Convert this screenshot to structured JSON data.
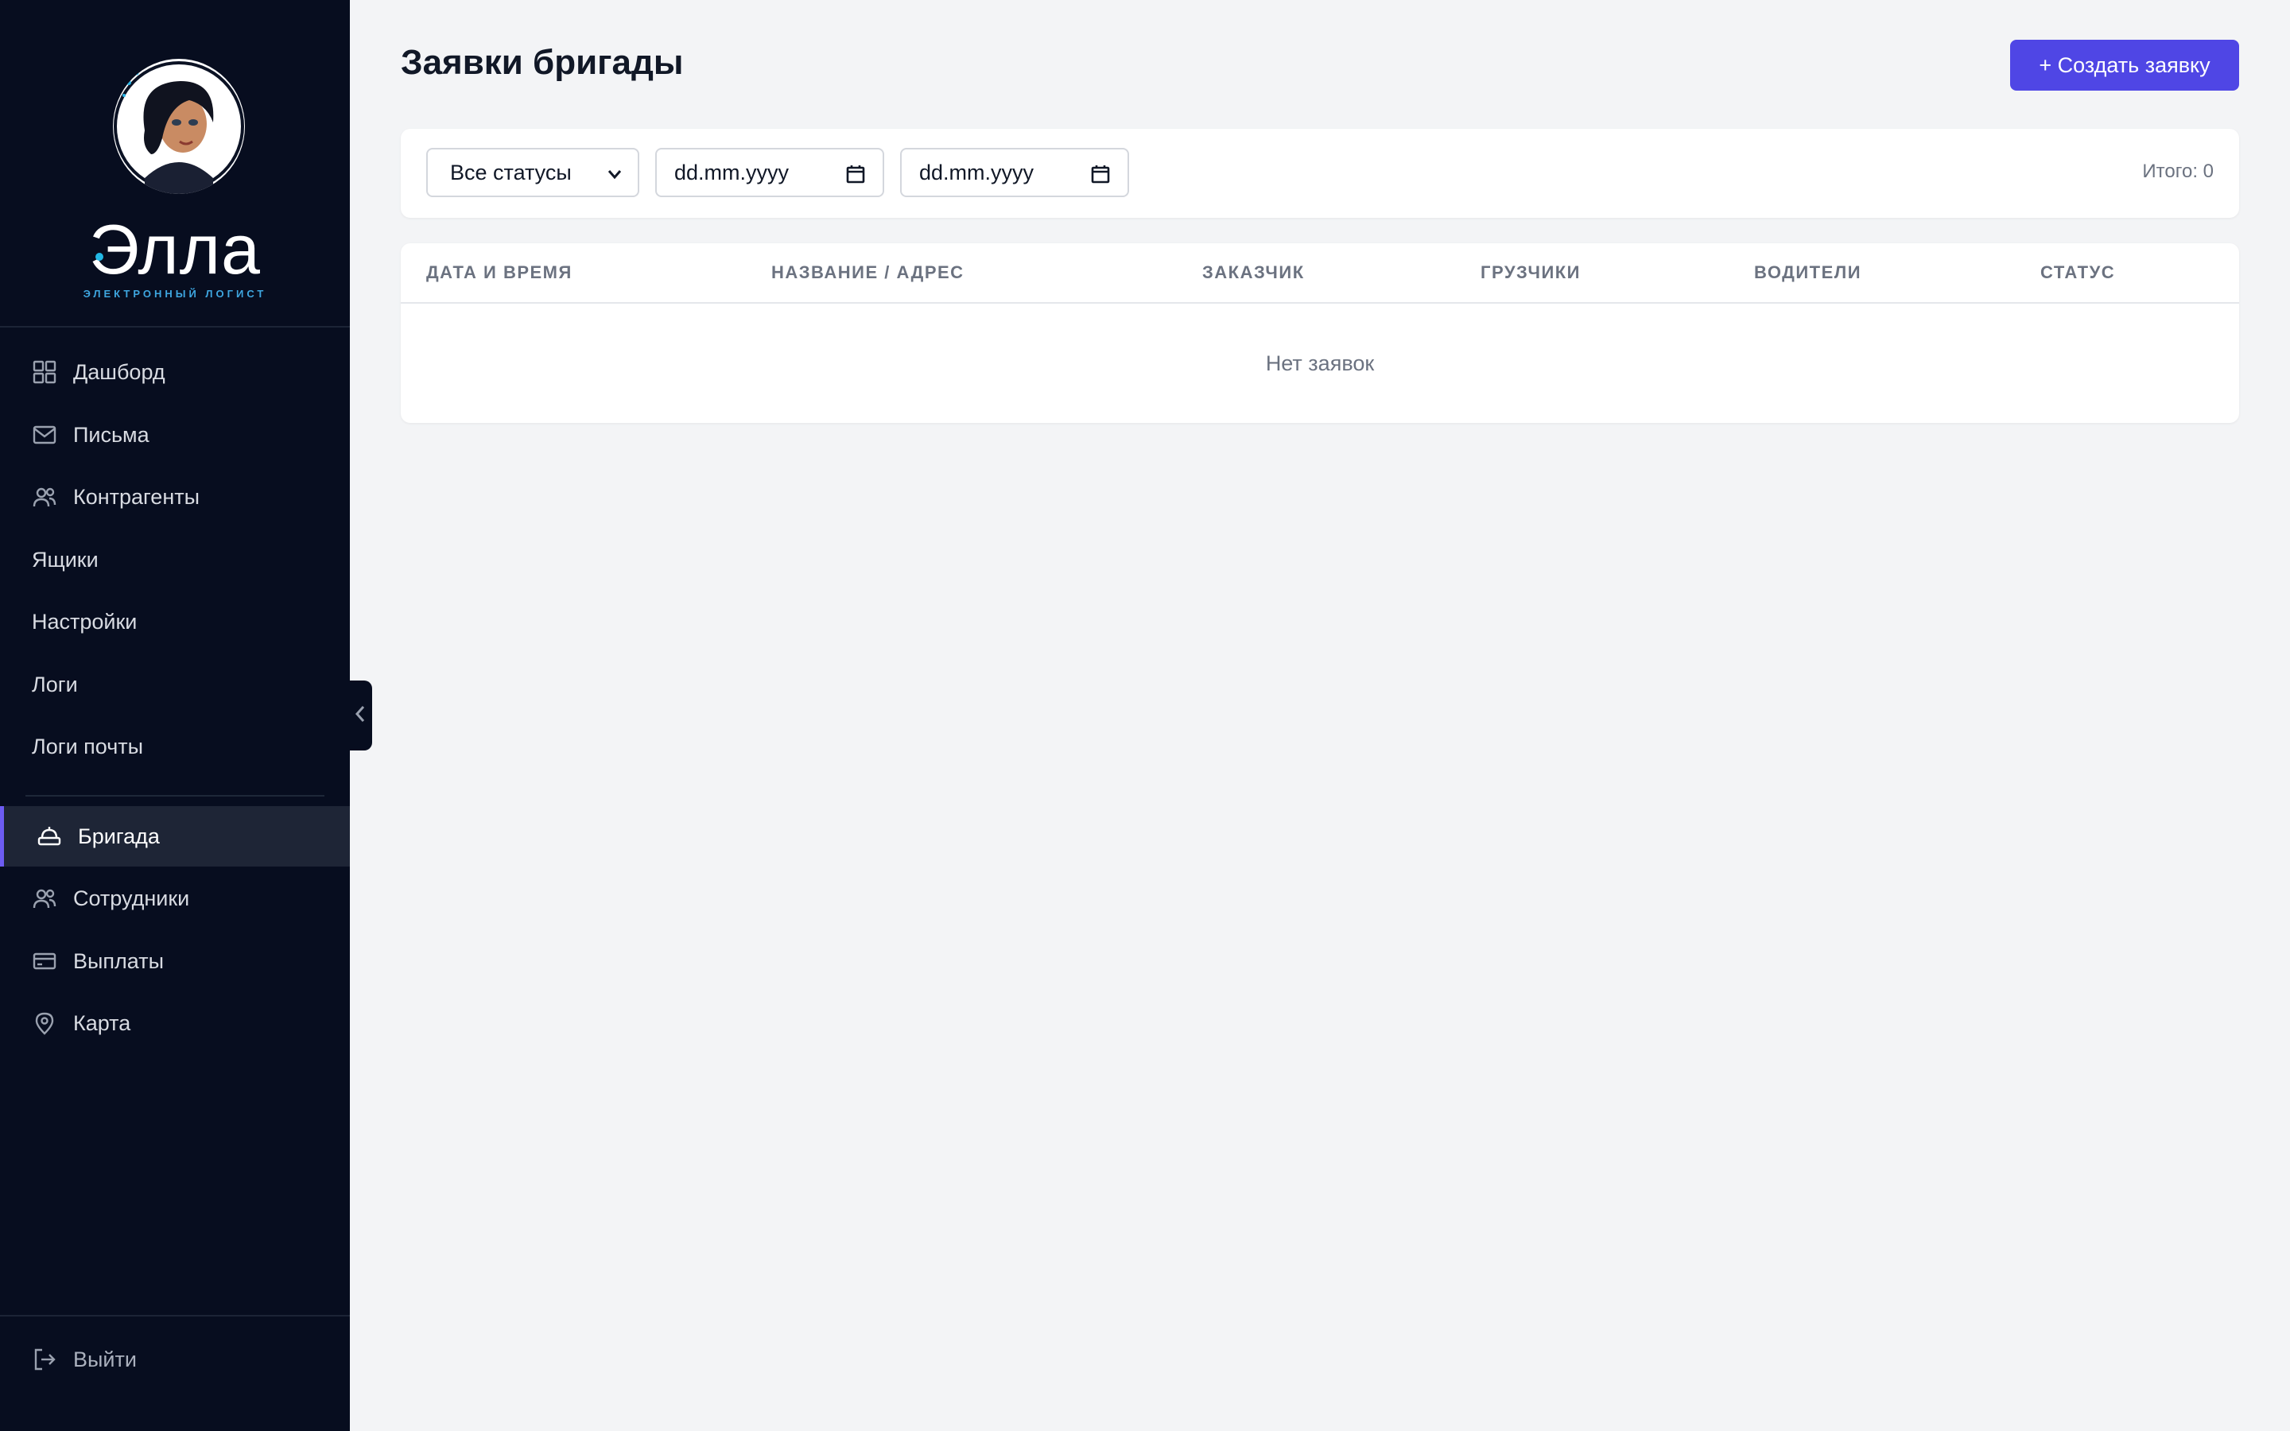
{
  "sidebar": {
    "logo_text": "Элла",
    "logo_subtitle": "ЭЛЕКТРОННЫЙ ЛОГИСТ",
    "items": [
      {
        "label": "Дашборд",
        "icon": "dashboard-grid-icon"
      },
      {
        "label": "Письма",
        "icon": "mail-icon"
      },
      {
        "label": "Контрагенты",
        "icon": "users-icon"
      },
      {
        "label": "Ящики",
        "icon": ""
      },
      {
        "label": "Настройки",
        "icon": ""
      },
      {
        "label": "Логи",
        "icon": ""
      },
      {
        "label": "Логи почты",
        "icon": ""
      },
      {
        "label": "Бригада",
        "icon": "brigade-helmet-icon",
        "active": true
      },
      {
        "label": "Сотрудники",
        "icon": "users-icon"
      },
      {
        "label": "Выплаты",
        "icon": "credit-card-icon"
      },
      {
        "label": "Карта",
        "icon": "map-pin-icon"
      }
    ],
    "logout_label": "Выйти",
    "accent_color": "#6d5cf2",
    "background_color": "#070d1f"
  },
  "main": {
    "title": "Заявки бригады",
    "create_button_label": "+ Создать заявку",
    "primary_color": "#4f46e5",
    "filters": {
      "status_selected": "Все статусы",
      "date_from_placeholder": "dd.mm.yyyy",
      "date_to_placeholder": "dd.mm.yyyy",
      "total_label": "Итого: 0"
    },
    "table": {
      "columns": [
        "ДАТА И ВРЕМЯ",
        "НАЗВАНИЕ / АДРЕС",
        "ЗАКАЗЧИК",
        "ГРУЗЧИКИ",
        "ВОДИТЕЛИ",
        "СТАТУС"
      ],
      "rows": [],
      "empty_text": "Нет заявок"
    }
  }
}
